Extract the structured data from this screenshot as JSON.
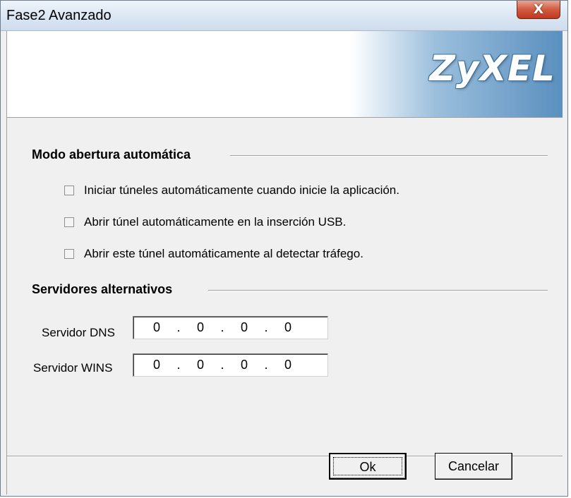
{
  "window": {
    "title": "Fase2 Avanzado",
    "close_label": "X"
  },
  "banner": {
    "logo_text": "ZyXEL"
  },
  "auto_open": {
    "section_title": "Modo abertura automática",
    "options": [
      {
        "label": "Iniciar túneles automáticamente cuando inicie la aplicación.",
        "checked": false
      },
      {
        "label": "Abrir túnel automáticamente en la inserción USB.",
        "checked": false
      },
      {
        "label": "Abrir este túnel automáticamente al detectar  tráfego.",
        "checked": false
      }
    ]
  },
  "alt_servers": {
    "section_title": "Servidores alternativos",
    "dns": {
      "label": "Servidor DNS",
      "octets": [
        "0",
        "0",
        "0",
        "0"
      ]
    },
    "wins": {
      "label": "Servidor WINS",
      "octets": [
        "0",
        "0",
        "0",
        "0"
      ]
    }
  },
  "buttons": {
    "ok": "Ok",
    "cancel": "Cancelar"
  }
}
